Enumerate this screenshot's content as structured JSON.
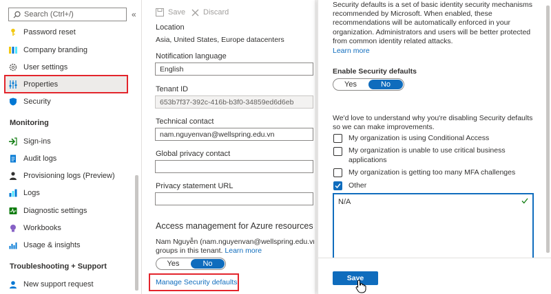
{
  "sidebar": {
    "search_placeholder": "Search (Ctrl+/)",
    "collapse_glyph": "«",
    "items_top": [
      {
        "label": "Password reset",
        "icon": "key-icon"
      },
      {
        "label": "Company branding",
        "icon": "branding-icon"
      },
      {
        "label": "User settings",
        "icon": "gear-icon"
      },
      {
        "label": "Properties",
        "icon": "sliders-icon"
      },
      {
        "label": "Security",
        "icon": "shield-icon"
      }
    ],
    "section_monitoring": "Monitoring",
    "items_monitoring": [
      {
        "label": "Sign-ins",
        "icon": "signin-icon"
      },
      {
        "label": "Audit logs",
        "icon": "document-icon"
      },
      {
        "label": "Provisioning logs (Preview)",
        "icon": "person-icon"
      },
      {
        "label": "Logs",
        "icon": "logs-icon"
      },
      {
        "label": "Diagnostic settings",
        "icon": "diagnostic-icon"
      },
      {
        "label": "Workbooks",
        "icon": "bulb-icon"
      },
      {
        "label": "Usage & insights",
        "icon": "chart-icon"
      }
    ],
    "section_support": "Troubleshooting + Support",
    "items_support": [
      {
        "label": "New support request",
        "icon": "support-icon"
      }
    ]
  },
  "toolbar": {
    "save_label": "Save",
    "discard_label": "Discard"
  },
  "properties": {
    "location_label": "Location",
    "location_value": "Asia, United States, Europe datacenters",
    "notif_label": "Notification language",
    "notif_value": "English",
    "tenant_label": "Tenant ID",
    "tenant_value": "653b7f37-392c-416b-b3f0-34859ed6d6eb",
    "tech_label": "Technical contact",
    "tech_value": "nam.nguyenvan@wellspring.edu.vn",
    "privacy_contact_label": "Global privacy contact",
    "privacy_contact_value": "",
    "privacy_url_label": "Privacy statement URL",
    "privacy_url_value": "",
    "access_heading": "Access management for Azure resources",
    "access_desc_1": "Nam Nguyễn (nam.nguyenvan@wellspring.edu.vn)",
    "access_desc_2": "groups in this tenant.",
    "learn_more": "Learn more",
    "toggle_yes": "Yes",
    "toggle_no": "No",
    "manage_link": "Manage Security defaults"
  },
  "security_panel": {
    "desc_lines": [
      "Security defaults is a set of basic identity security mechanisms",
      "recommended by Microsoft. When enabled, these",
      "recommendations will be automatically enforced in your",
      "organization. Administrators and users will be better protected",
      "from common identity related attacks."
    ],
    "learn_more": "Learn more",
    "enable_label": "Enable Security defaults",
    "toggle_yes": "Yes",
    "toggle_no": "No",
    "reason_line1": "We'd love to understand why you're disabling Security defaults",
    "reason_line2": "so we can make improvements.",
    "options": [
      {
        "label": "My organization is using Conditional Access",
        "checked": false
      },
      {
        "label": "My organization is unable to use critical business",
        "label2": "applications",
        "checked": false
      },
      {
        "label": "My organization is getting too many MFA challenges",
        "checked": false
      },
      {
        "label": "Other",
        "checked": true
      }
    ],
    "textarea_value": "N/A",
    "save_label": "Save"
  },
  "colors": {
    "accent": "#0f6cbd",
    "highlight_box": "#e3242b"
  }
}
